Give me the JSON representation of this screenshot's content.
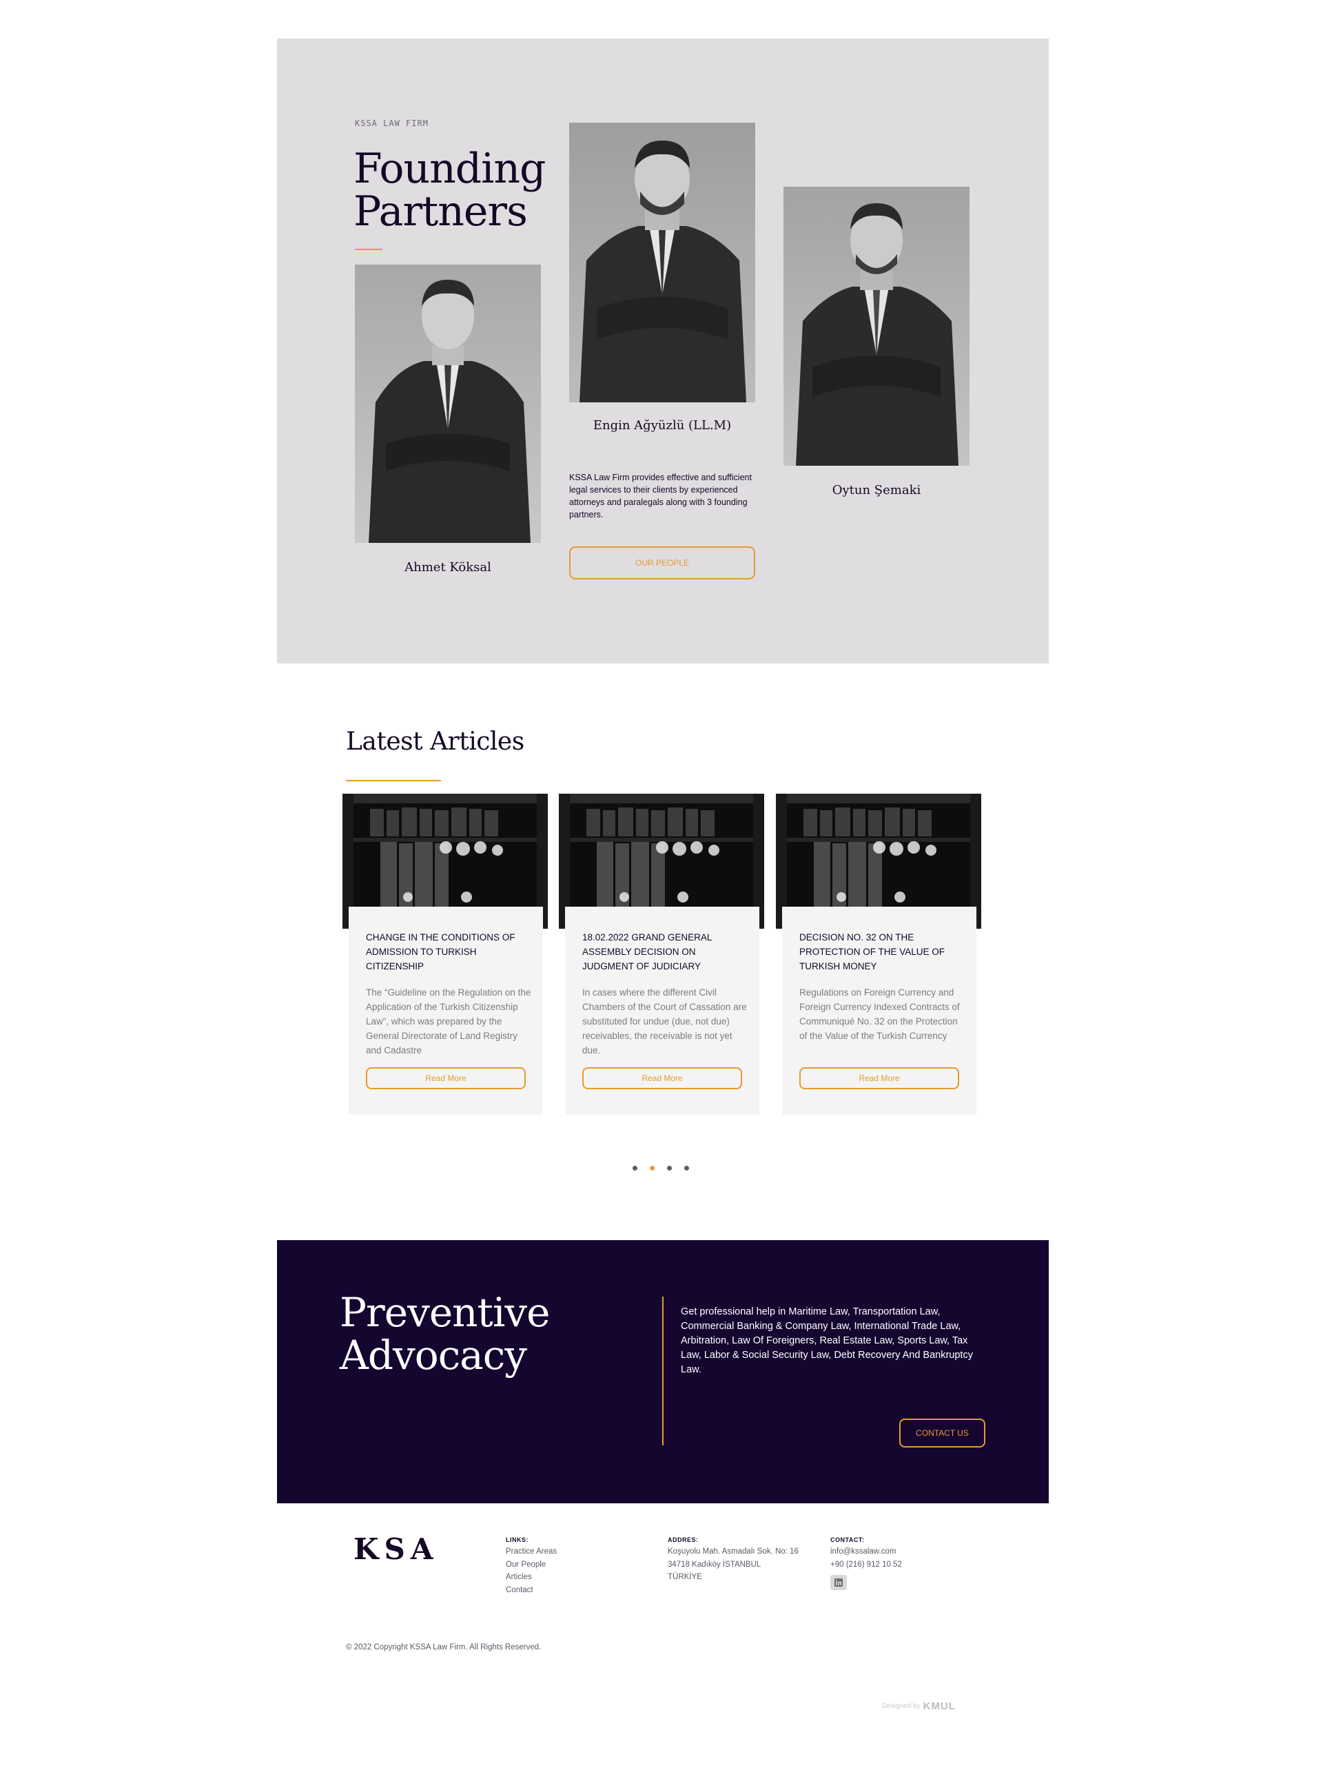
{
  "partners": {
    "eyebrow": "KSSA LAW FIRM",
    "title": "Founding Partners",
    "people": [
      {
        "name": "Ahmet Köksal"
      },
      {
        "name": "Engin Ağyüzlü (LL.M)"
      },
      {
        "name": "Oytun Şemaki"
      }
    ],
    "description": "KSSA Law Firm provides effective and sufficient legal services to their clients by experienced attorneys and paralegals along with 3 founding partners.",
    "button": "OUR PEOPLE"
  },
  "articles": {
    "title": "Latest Articles",
    "items": [
      {
        "title": "CHANGE IN THE CONDITIONS OF ADMISSION TO TURKISH CITIZENSHIP",
        "excerpt": "The “Guideline on the Regulation on the Application of the Turkish Citizenship Law”, which was prepared by the General Directorate of Land Registry and Cadastre",
        "button": "Read More"
      },
      {
        "title": "18.02.2022 GRAND GENERAL ASSEMBLY DECISION ON JUDGMENT OF JUDICIARY",
        "excerpt": "In cases where the different Civil Chambers of the Court of Cassation are substituted for undue (due, not due) receivables, the receivable is not yet due.",
        "button": "Read More"
      },
      {
        "title": "DECISION NO. 32 ON THE PROTECTION OF THE VALUE OF TURKISH MONEY",
        "excerpt": "Regulations on Foreign Currency and Foreign Currency Indexed Contracts of Communiqué No. 32 on the Protection of the Value of the Turkish Currency",
        "button": "Read More"
      }
    ],
    "pagination": {
      "count": 4,
      "active": 2
    }
  },
  "advocacy": {
    "title": "Preventive Advocacy",
    "text": "Get professional help in Maritime Law, Transportation Law, Commercial Banking & Company Law, International Trade Law, Arbitration, Law Of Foreigners, Real Estate Law,  Sports Law, Tax Law, Labor & Social Security Law, Debt Recovery And Bankruptcy Law.",
    "button": "CONTACT US"
  },
  "footer": {
    "logo": "KSA",
    "links": {
      "heading": "LINKS:",
      "items": [
        "Practice Areas",
        "Our People",
        "Articles",
        "Contact"
      ]
    },
    "address": {
      "heading": "ADDRES:",
      "lines": [
        "Koşuyolu Mah. Asmadalı Sok. No: 16",
        "34718 Kadıköy İSTANBUL",
        "TÜRKİYE"
      ]
    },
    "contact": {
      "heading": "CONTACT:",
      "email": "info@kssalaw.com",
      "phone": "+90 (216) 912 10 52",
      "social_icon": "linkedin-icon"
    },
    "copyright": "© 2022 Copyright KSSA Law Firm. All Rights Reserved.",
    "designed_by": "Designed by",
    "designer": "KMUL"
  },
  "colors": {
    "accent": "#e79a2f",
    "navy": "#150826",
    "advocacy_bg": "#150630",
    "partners_bg": "#dfdddf",
    "card_bg": "#f4f4f4"
  }
}
